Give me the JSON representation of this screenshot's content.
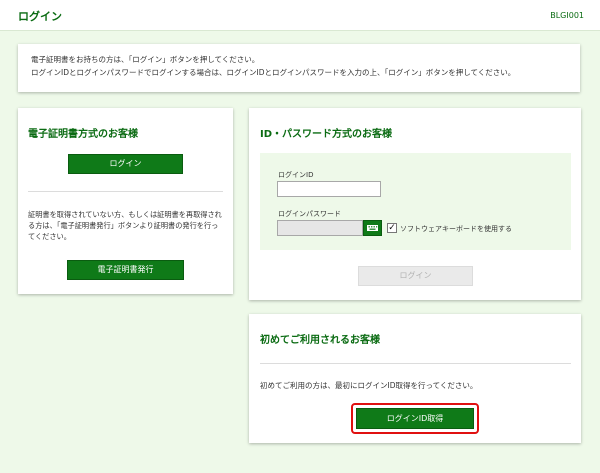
{
  "header": {
    "title": "ログイン",
    "screen_code": "BLGI001"
  },
  "notice": {
    "line1": "電子証明書をお持ちの方は、「ログイン」ボタンを押してください。",
    "line2": "ログインIDとログインパスワードでログインする場合は、ログインIDとログインパスワードを入力の上、「ログイン」ボタンを押してください。"
  },
  "cert_section": {
    "title": "電子証明書方式のお客様",
    "login_label": "ログイン",
    "description": "証明書を取得されていない方、もしくは証明書を再取得される方は、「電子証明書発行」ボタンより証明書の発行を行ってください。",
    "issue_label": "電子証明書発行"
  },
  "idpw_section": {
    "title": "ID・パスワード方式のお客様",
    "id_label": "ログインID",
    "id_value": "",
    "password_label": "ログインパスワード",
    "password_value": "",
    "software_keyboard_label": "ソフトウェアキーボードを使用する",
    "software_keyboard_checked": "✓",
    "login_label": "ログイン"
  },
  "first_time_section": {
    "title": "初めてご利用されるお客様",
    "description": "初めてご利用の方は、最初にログインID取得を行ってください。",
    "get_id_label": "ログインID取得"
  },
  "colors": {
    "accent": "#0f7a18",
    "heading": "#0a6b12",
    "background": "#eef9e9",
    "highlight": "#e01010"
  }
}
